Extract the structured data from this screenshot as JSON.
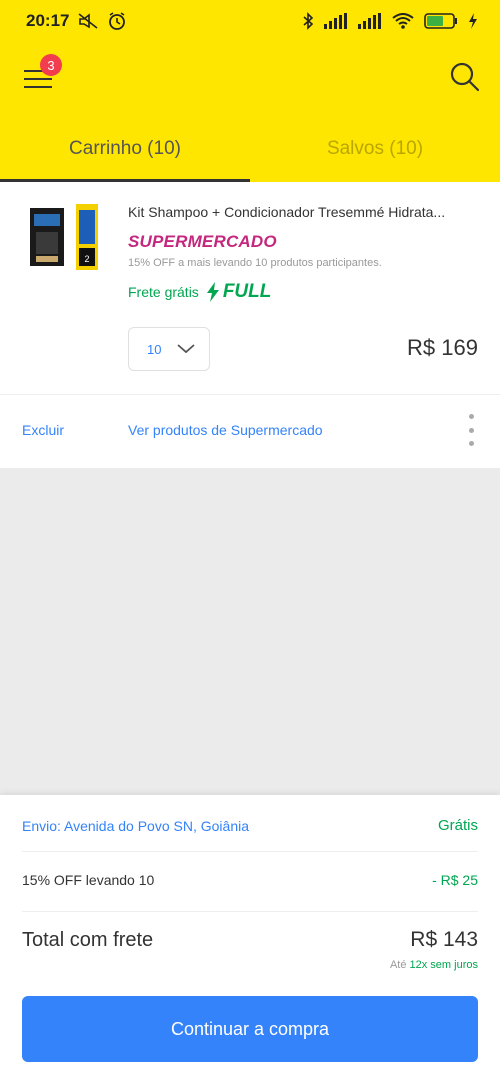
{
  "status_bar": {
    "time": "20:17",
    "battery": "53"
  },
  "header": {
    "menu_badge": "3"
  },
  "tabs": [
    {
      "label": "Carrinho (10)",
      "active": true
    },
    {
      "label": "Salvos (10)",
      "active": false
    }
  ],
  "product": {
    "title": "Kit Shampoo + Condicionador Tresemmé Hidrata...",
    "store": "SUPERMERCADO",
    "promo": "15% OFF a mais levando 10 produtos participantes.",
    "shipping": "Frete grátis",
    "full_label": "FULL",
    "quantity": "10",
    "price": "R$ 169"
  },
  "actions": {
    "delete": "Excluir",
    "see_more": "Ver produtos de Supermercado"
  },
  "summary": {
    "shipping_label": "Envio: Avenida do Povo SN, Goiânia",
    "shipping_value": "Grátis",
    "discount_label": "15% OFF levando 10",
    "discount_value": "- R$ 25",
    "total_label": "Total com frete",
    "total_value": "R$ 143",
    "installments_prefix": "Até",
    "installments_highlight": "12x sem juros"
  },
  "cta": {
    "label": "Continuar a compra"
  },
  "colors": {
    "brand_yellow": "#ffe600",
    "link_blue": "#3483fa",
    "success_green": "#00a650",
    "store_pink": "#c4277e",
    "badge_red": "#f23d4f"
  }
}
